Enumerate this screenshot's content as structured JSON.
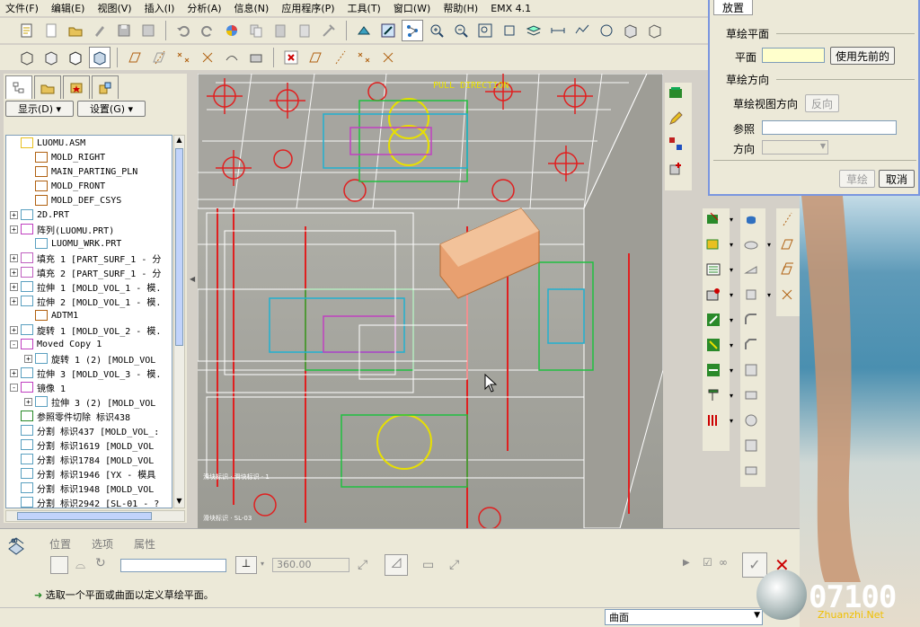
{
  "menu": [
    "文件(F)",
    "编辑(E)",
    "视图(V)",
    "插入(I)",
    "分析(A)",
    "信息(N)",
    "应用程序(P)",
    "工具(T)",
    "窗口(W)",
    "帮助(H)",
    "EMX 4.1"
  ],
  "tree_panel": {
    "buttons": {
      "show": "显示(D) ▾",
      "settings": "设置(G) ▾"
    },
    "items": [
      {
        "label": "LUOMU.ASM",
        "indent": 0,
        "expander": "",
        "icon": "assembly-icon"
      },
      {
        "label": "MOLD_RIGHT",
        "indent": 1,
        "expander": "",
        "icon": "datum-plane-icon"
      },
      {
        "label": "MAIN_PARTING_PLN",
        "indent": 1,
        "expander": "",
        "icon": "datum-plane-icon"
      },
      {
        "label": "MOLD_FRONT",
        "indent": 1,
        "expander": "",
        "icon": "datum-plane-icon"
      },
      {
        "label": "MOLD_DEF_CSYS",
        "indent": 1,
        "expander": "",
        "icon": "csys-icon"
      },
      {
        "label": "2D.PRT",
        "indent": 0,
        "expander": "+",
        "icon": "part-icon"
      },
      {
        "label": "阵列(LUOMU.PRT)",
        "indent": 0,
        "expander": "+",
        "icon": "pattern-icon"
      },
      {
        "label": "LUOMU_WRK.PRT",
        "indent": 1,
        "expander": "",
        "icon": "part-icon"
      },
      {
        "label": "填充 1 [PART_SURF_1 - 分",
        "indent": 0,
        "expander": "+",
        "icon": "fill-icon"
      },
      {
        "label": "填充 2 [PART_SURF_1 - 分",
        "indent": 0,
        "expander": "+",
        "icon": "fill-icon"
      },
      {
        "label": "拉伸 1 [MOLD_VOL_1 - 模.",
        "indent": 0,
        "expander": "+",
        "icon": "extrude-icon"
      },
      {
        "label": "拉伸 2 [MOLD_VOL_1 - 模.",
        "indent": 0,
        "expander": "+",
        "icon": "extrude-icon"
      },
      {
        "label": "ADTM1",
        "indent": 1,
        "expander": "",
        "icon": "datum-plane-icon"
      },
      {
        "label": "旋转 1 [MOLD_VOL_2 - 模.",
        "indent": 0,
        "expander": "+",
        "icon": "revolve-icon"
      },
      {
        "label": "Moved Copy 1",
        "indent": 0,
        "expander": "-",
        "icon": "copy-icon"
      },
      {
        "label": "旋转 1 (2) [MOLD_VOL",
        "indent": 1,
        "expander": "+",
        "icon": "revolve-icon"
      },
      {
        "label": "拉伸 3 [MOLD_VOL_3 - 模.",
        "indent": 0,
        "expander": "+",
        "icon": "extrude-icon"
      },
      {
        "label": "镜像 1",
        "indent": 0,
        "expander": "-",
        "icon": "mirror-icon"
      },
      {
        "label": "拉伸 3 (2) [MOLD_VOL",
        "indent": 1,
        "expander": "+",
        "icon": "extrude-icon"
      },
      {
        "label": "参照零件切除 标识438",
        "indent": 0,
        "expander": "",
        "icon": "cut-icon"
      },
      {
        "label": "分割 标识437 [MOLD_VOL_:",
        "indent": 0,
        "expander": "",
        "icon": "split-icon"
      },
      {
        "label": "分割 标识1619 [MOLD_VOL",
        "indent": 0,
        "expander": "",
        "icon": "split-icon"
      },
      {
        "label": "分割 标识1784 [MOLD_VOL",
        "indent": 0,
        "expander": "",
        "icon": "split-icon"
      },
      {
        "label": "分割 标识1946 [YX - 模具",
        "indent": 0,
        "expander": "",
        "icon": "split-icon"
      },
      {
        "label": "分割 标识1948 [MOLD_VOL",
        "indent": 0,
        "expander": "",
        "icon": "split-icon"
      },
      {
        "label": "分割 标识2942 [SL-01 - ?",
        "indent": 0,
        "expander": "",
        "icon": "split-icon"
      }
    ]
  },
  "viewport": {
    "annotation": "PULL DIRECTION",
    "small_labels": [
      "滑块标识 · 滑块标识 · 1",
      "滑块标识 · SL-03"
    ]
  },
  "dashboard": {
    "tabs": [
      "位置",
      "选项",
      "属性"
    ],
    "depth_value": "360.00",
    "status": "选取一个平面或曲面以定义草绘平面。"
  },
  "filter": {
    "value": "曲面"
  },
  "dialog": {
    "tab": "放置",
    "sketch_plane_group": "草绘平面",
    "plane_label": "平面",
    "use_previous": "使用先前的",
    "sketch_orientation_group": "草绘方向",
    "view_dir_label": "草绘视图方向",
    "flip": "反向",
    "reference_label": "参照",
    "direction_label": "方向",
    "sketch_button": "草绘",
    "cancel_button": "取消"
  },
  "watermark": {
    "logo": "07100",
    "site": "Zhuanzhi.Net"
  },
  "colors": {
    "accent_blue": "#7a96df",
    "sketch_red": "#e02020",
    "model_yellow": "#e8e000",
    "block_orange": "#e8a070"
  }
}
